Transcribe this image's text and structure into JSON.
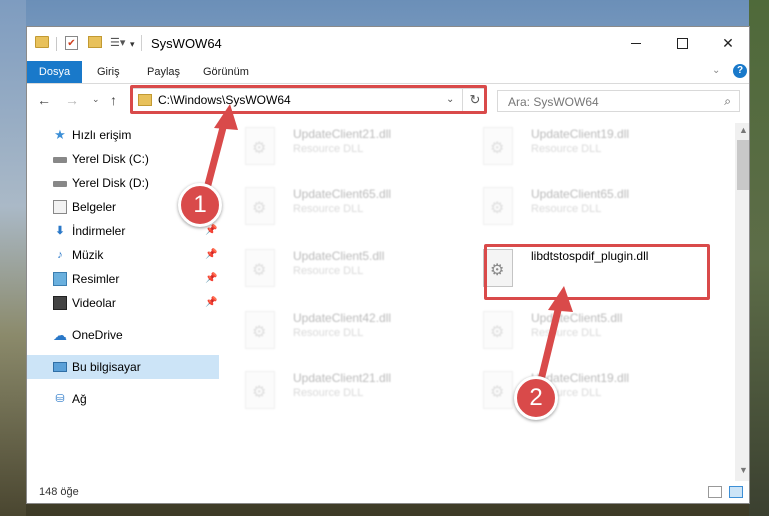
{
  "window": {
    "title": "SysWOW64",
    "minimize_label": "",
    "maximize_label": "",
    "close_label": "✕"
  },
  "ribbon": {
    "tabs": [
      "Dosya",
      "Giriş",
      "Paylaş",
      "Görünüm"
    ],
    "help": "?"
  },
  "address": {
    "path": "C:\\Windows\\SysWOW64",
    "search_placeholder": "Ara: SysWOW64"
  },
  "sidebar": {
    "items": [
      {
        "label": "Hızlı erişim",
        "icon": "star-icon",
        "pinned": false
      },
      {
        "label": "Yerel Disk (C:)",
        "icon": "drive-icon",
        "pinned": false
      },
      {
        "label": "Yerel Disk (D:)",
        "icon": "drive-icon",
        "pinned": false
      },
      {
        "label": "Belgeler",
        "icon": "documents-icon",
        "pinned": false
      },
      {
        "label": "İndirmeler",
        "icon": "downloads-icon",
        "pinned": true
      },
      {
        "label": "Müzik",
        "icon": "music-icon",
        "pinned": true
      },
      {
        "label": "Resimler",
        "icon": "pictures-icon",
        "pinned": true
      },
      {
        "label": "Videolar",
        "icon": "videos-icon",
        "pinned": true
      },
      {
        "label": "OneDrive",
        "icon": "cloud-icon",
        "pinned": false
      },
      {
        "label": "Bu bilgisayar",
        "icon": "computer-icon",
        "pinned": false,
        "selected": true
      },
      {
        "label": "Ağ",
        "icon": "network-icon",
        "pinned": false
      }
    ]
  },
  "files": [
    {
      "name": "UpdateClient21.dll",
      "type": "Resource DLL",
      "blurred": true
    },
    {
      "name": "UpdateClient19.dll",
      "type": "Resource DLL",
      "blurred": true
    },
    {
      "name": "UpdateClient65.dll",
      "type": "Resource DLL",
      "blurred": true
    },
    {
      "name": "UpdateClient65.dll",
      "type": "Resource DLL",
      "blurred": true
    },
    {
      "name": "UpdateClient5.dll",
      "type": "Resource DLL",
      "blurred": true
    },
    {
      "name": "libdtstospdif_plugin.dll",
      "type": "",
      "blurred": false
    },
    {
      "name": "UpdateClient42.dll",
      "type": "Resource DLL",
      "blurred": true
    },
    {
      "name": "UpdateClient5.dll",
      "type": "Resource DLL",
      "blurred": true
    },
    {
      "name": "UpdateClient21.dll",
      "type": "Resource DLL",
      "blurred": true
    },
    {
      "name": "UpdateClient19.dll",
      "type": "Resource DLL",
      "blurred": true
    }
  ],
  "status": {
    "item_count": "148 öğe"
  },
  "callouts": {
    "step1": "1",
    "step2": "2",
    "color": "#d94a4a"
  }
}
